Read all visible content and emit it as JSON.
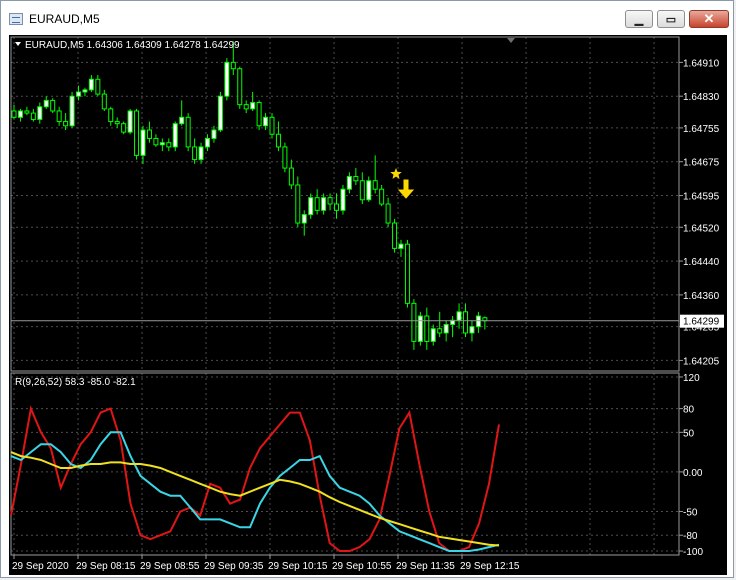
{
  "window": {
    "title": "EURAUD,M5",
    "buttons": {
      "minimize": "▁",
      "maximize": "▭",
      "close": "✕"
    }
  },
  "price_panel": {
    "header": "EURAUD,M5  1.64306 1.64309 1.64278 1.64299",
    "current_price_label": "1.64299",
    "tick_labels": [
      "1.64910",
      "1.64830",
      "1.64755",
      "1.64675",
      "1.64595",
      "1.64520",
      "1.64440",
      "1.64360",
      "1.64285",
      "1.64205"
    ]
  },
  "indicator_panel": {
    "header": "R(9,26,52) 58.3 -85.0 -82.1",
    "tick_labels": [
      "120",
      "80",
      "50",
      "0.00",
      "-50",
      "-80",
      "-100"
    ]
  },
  "time_axis": {
    "labels": [
      "29 Sep 2020",
      "29 Sep 08:15",
      "29 Sep 08:55",
      "29 Sep 09:35",
      "29 Sep 10:15",
      "29 Sep 10:55",
      "29 Sep 11:35",
      "29 Sep 12:15"
    ]
  },
  "colors": {
    "background": "#000000",
    "grid": "#4d4d4d",
    "axis_text": "#ffffff",
    "bull_candle": "#ffffff",
    "bear_candle": "#000000",
    "candle_wick": "#00ff00",
    "signal_arrow": "#ffd700",
    "line_fast": "#e01515",
    "line_mid": "#3ad6e6",
    "line_slow": "#f0e020"
  },
  "chart_data": [
    {
      "type": "candlestick",
      "symbol": "EURAUD",
      "timeframe": "M5",
      "ohlc_last": {
        "open": 1.64306,
        "high": 1.64309,
        "low": 1.64278,
        "close": 1.64299
      },
      "ylim": [
        1.6418,
        1.6497
      ],
      "candles": [
        [
          1.64795,
          1.6481,
          1.64775,
          1.6478
        ],
        [
          1.6478,
          1.648,
          1.6477,
          1.64795
        ],
        [
          1.64795,
          1.64805,
          1.64785,
          1.6479
        ],
        [
          1.6479,
          1.648,
          1.6477,
          1.64775
        ],
        [
          1.64775,
          1.64815,
          1.64765,
          1.64805
        ],
        [
          1.64805,
          1.6483,
          1.648,
          1.6482
        ],
        [
          1.6482,
          1.64825,
          1.6479,
          1.64795
        ],
        [
          1.64795,
          1.64805,
          1.6476,
          1.6477
        ],
        [
          1.6477,
          1.6479,
          1.6475,
          1.6476
        ],
        [
          1.6476,
          1.6484,
          1.64755,
          1.6483
        ],
        [
          1.6483,
          1.64855,
          1.6482,
          1.6484
        ],
        [
          1.6484,
          1.6485,
          1.6483,
          1.64845
        ],
        [
          1.64845,
          1.6488,
          1.6484,
          1.6487
        ],
        [
          1.6487,
          1.6488,
          1.6483,
          1.64835
        ],
        [
          1.64835,
          1.64845,
          1.64795,
          1.648
        ],
        [
          1.648,
          1.64805,
          1.6476,
          1.6477
        ],
        [
          1.6477,
          1.6478,
          1.64755,
          1.64765
        ],
        [
          1.64765,
          1.6477,
          1.6474,
          1.64745
        ],
        [
          1.64745,
          1.648,
          1.6474,
          1.64795
        ],
        [
          1.64795,
          1.648,
          1.6468,
          1.6469
        ],
        [
          1.6469,
          1.6476,
          1.6467,
          1.6475
        ],
        [
          1.6475,
          1.6477,
          1.6472,
          1.6473
        ],
        [
          1.6473,
          1.6474,
          1.6471,
          1.64715
        ],
        [
          1.64715,
          1.6473,
          1.647,
          1.6472
        ],
        [
          1.6472,
          1.6473,
          1.647,
          1.6471
        ],
        [
          1.6471,
          1.6477,
          1.647,
          1.64765
        ],
        [
          1.64765,
          1.6482,
          1.6476,
          1.6478
        ],
        [
          1.6478,
          1.6479,
          1.647,
          1.6471
        ],
        [
          1.6471,
          1.6473,
          1.6467,
          1.6468
        ],
        [
          1.6468,
          1.6472,
          1.6467,
          1.6471
        ],
        [
          1.6471,
          1.6474,
          1.647,
          1.6473
        ],
        [
          1.6473,
          1.6476,
          1.6472,
          1.6475
        ],
        [
          1.6475,
          1.6484,
          1.64745,
          1.6483
        ],
        [
          1.6483,
          1.6492,
          1.6482,
          1.6491
        ],
        [
          1.6491,
          1.6496,
          1.6488,
          1.64895
        ],
        [
          1.64895,
          1.649,
          1.648,
          1.6481
        ],
        [
          1.6481,
          1.6482,
          1.6479,
          1.648
        ],
        [
          1.648,
          1.6484,
          1.64795,
          1.64815
        ],
        [
          1.64815,
          1.6482,
          1.6475,
          1.6476
        ],
        [
          1.6476,
          1.6479,
          1.6475,
          1.6478
        ],
        [
          1.6478,
          1.6479,
          1.6473,
          1.6474
        ],
        [
          1.6474,
          1.6477,
          1.647,
          1.6471
        ],
        [
          1.6471,
          1.6472,
          1.6465,
          1.6466
        ],
        [
          1.6466,
          1.6468,
          1.6461,
          1.6462
        ],
        [
          1.6462,
          1.6464,
          1.6452,
          1.6453
        ],
        [
          1.6453,
          1.6456,
          1.645,
          1.6455
        ],
        [
          1.6455,
          1.646,
          1.6454,
          1.6459
        ],
        [
          1.6459,
          1.6461,
          1.6455,
          1.6456
        ],
        [
          1.6456,
          1.646,
          1.6455,
          1.6459
        ],
        [
          1.6459,
          1.646,
          1.6456,
          1.64575
        ],
        [
          1.64575,
          1.646,
          1.6454,
          1.6456
        ],
        [
          1.6456,
          1.6462,
          1.6455,
          1.6461
        ],
        [
          1.6461,
          1.6465,
          1.646,
          1.6464
        ],
        [
          1.6464,
          1.6466,
          1.6462,
          1.6463
        ],
        [
          1.6463,
          1.6465,
          1.64575,
          1.64585
        ],
        [
          1.64585,
          1.6464,
          1.6458,
          1.6463
        ],
        [
          1.6463,
          1.6469,
          1.646,
          1.6461
        ],
        [
          1.6461,
          1.6462,
          1.6457,
          1.64575
        ],
        [
          1.64575,
          1.6459,
          1.6452,
          1.6453
        ],
        [
          1.6453,
          1.6454,
          1.6446,
          1.6447
        ],
        [
          1.6447,
          1.6449,
          1.6445,
          1.6448
        ],
        [
          1.6448,
          1.6449,
          1.6433,
          1.6434
        ],
        [
          1.6434,
          1.6435,
          1.6423,
          1.6425
        ],
        [
          1.6425,
          1.6432,
          1.6424,
          1.6431
        ],
        [
          1.6431,
          1.6433,
          1.6423,
          1.6425
        ],
        [
          1.6425,
          1.6429,
          1.6424,
          1.6428
        ],
        [
          1.6428,
          1.6432,
          1.6426,
          1.6427
        ],
        [
          1.6427,
          1.643,
          1.6425,
          1.6429
        ],
        [
          1.6429,
          1.6431,
          1.6426,
          1.643
        ],
        [
          1.643,
          1.6434,
          1.6428,
          1.6432
        ],
        [
          1.6432,
          1.6434,
          1.6426,
          1.6427
        ],
        [
          1.6427,
          1.643,
          1.6425,
          1.64285
        ],
        [
          1.64285,
          1.6432,
          1.6427,
          1.6431
        ],
        [
          1.64306,
          1.64309,
          1.64278,
          1.64299
        ]
      ]
    },
    {
      "type": "line",
      "ylim": [
        -105,
        125
      ],
      "series": [
        {
          "color": "#e01515",
          "values": [
            -55,
            10,
            80,
            50,
            30,
            -20,
            10,
            35,
            50,
            75,
            80,
            40,
            -40,
            -80,
            -85,
            -80,
            -75,
            -50,
            -45,
            -55,
            -15,
            -20,
            -40,
            -35,
            5,
            30,
            45,
            60,
            75,
            75,
            40,
            -30,
            -90,
            -100,
            -100,
            -95,
            -85,
            -60,
            -5,
            55,
            75,
            10,
            -50,
            -90,
            -100,
            -100,
            -95,
            -65,
            -15,
            60
          ]
        },
        {
          "color": "#3ad6e6",
          "values": [
            20,
            15,
            25,
            35,
            35,
            25,
            10,
            5,
            15,
            35,
            50,
            50,
            20,
            -5,
            -15,
            -25,
            -30,
            -30,
            -45,
            -60,
            -60,
            -60,
            -65,
            -70,
            -70,
            -40,
            -20,
            -5,
            5,
            15,
            15,
            20,
            -5,
            -20,
            -25,
            -30,
            -40,
            -55,
            -65,
            -75,
            -80,
            -85,
            -90,
            -95,
            -100,
            -100,
            -100,
            -98,
            -95,
            -92
          ]
        },
        {
          "color": "#f0e020",
          "values": [
            25,
            20,
            18,
            15,
            10,
            5,
            5,
            8,
            10,
            10,
            12,
            12,
            10,
            10,
            8,
            5,
            0,
            -5,
            -10,
            -15,
            -20,
            -25,
            -28,
            -30,
            -25,
            -20,
            -15,
            -10,
            -12,
            -15,
            -20,
            -25,
            -32,
            -38,
            -43,
            -48,
            -53,
            -58,
            -62,
            -66,
            -70,
            -74,
            -78,
            -82,
            -84,
            -86,
            -88,
            -90,
            -92,
            -93
          ]
        }
      ]
    }
  ]
}
